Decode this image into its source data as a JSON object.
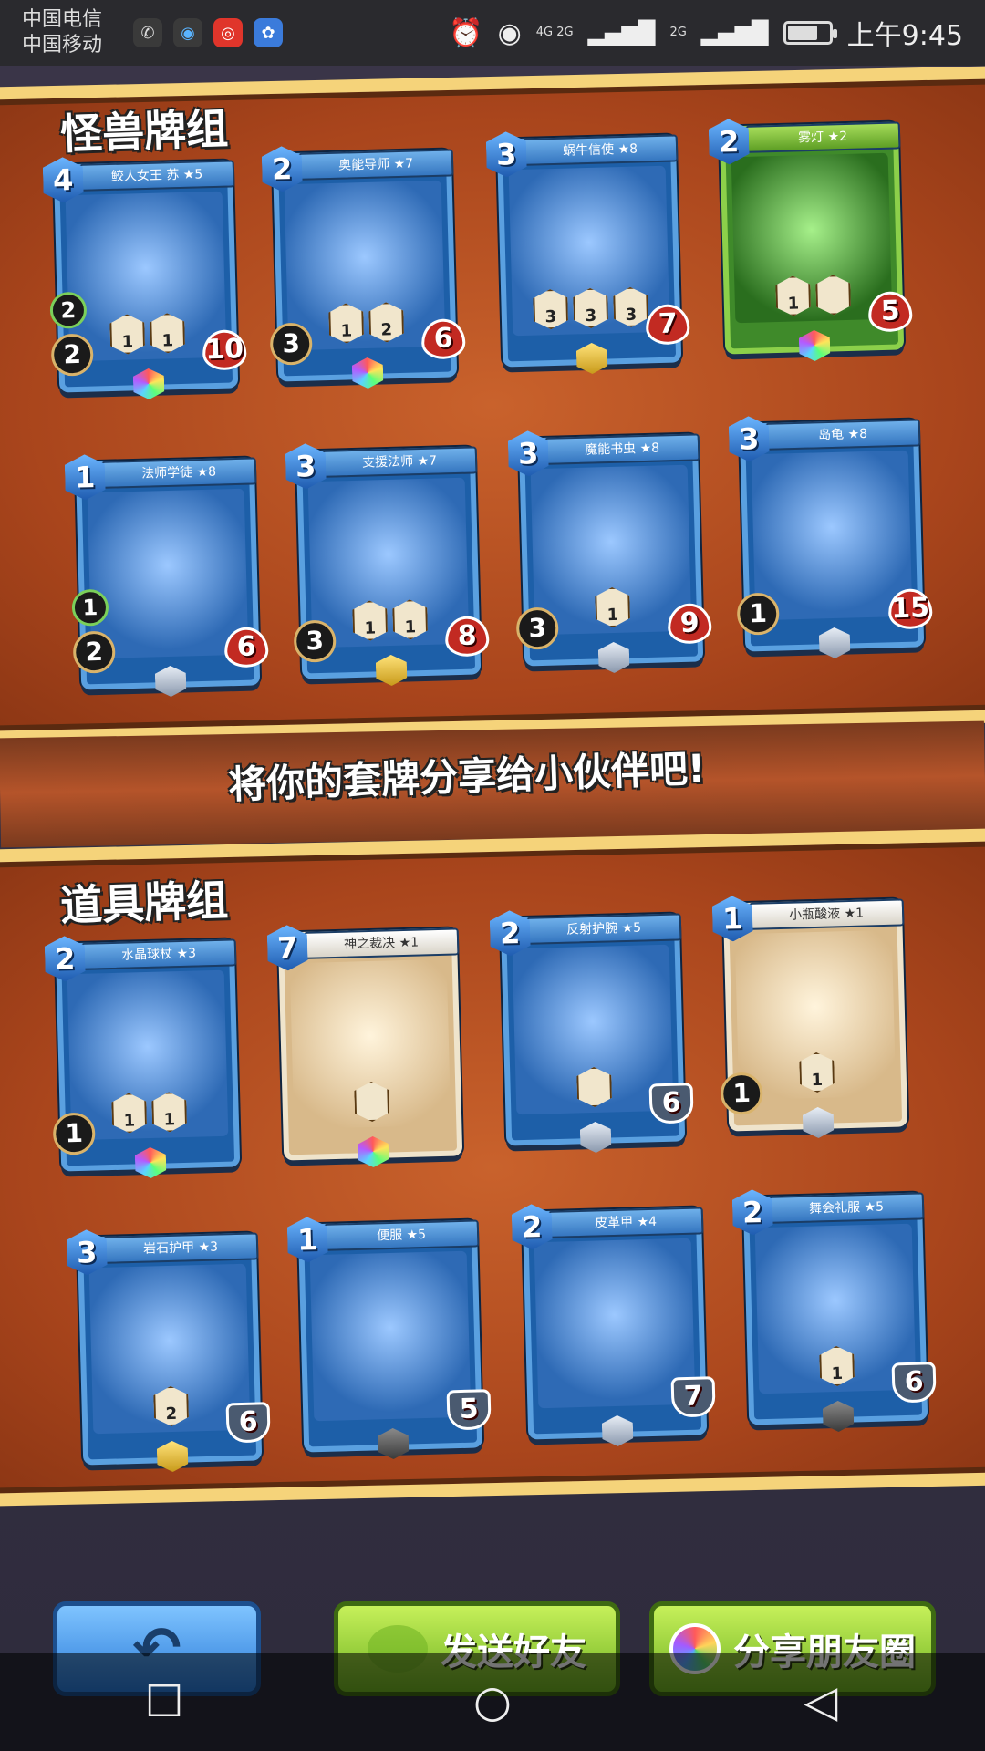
{
  "status_bar": {
    "carrier1": "中国电信",
    "carrier2": "中国移动",
    "net_top": "4G 2G",
    "net_right": "2G",
    "time": "上午9:45",
    "icons": [
      "wechat-icon",
      "qq-icon",
      "weibo-icon",
      "baidu-icon",
      "alarm-icon",
      "eye-icon",
      "signal-icon",
      "battery-icon"
    ]
  },
  "sections": {
    "monster_title": "怪兽牌组",
    "item_title": "道具牌组",
    "share_message": "将你的套牌分享给小伙伴吧!"
  },
  "monster_cards": [
    {
      "name": "鲛人女王 苏 ★5",
      "cost": "4",
      "left": "2",
      "left2": "2",
      "right": "10",
      "skills": [
        "1",
        "1"
      ]
    },
    {
      "name": "奥能导师 ★7",
      "cost": "2",
      "left": "3",
      "right": "6",
      "skills": [
        "1",
        "2"
      ]
    },
    {
      "name": "蜗牛信使 ★8",
      "cost": "3",
      "right": "7",
      "skills": [
        "3",
        "3",
        "3"
      ]
    },
    {
      "name": "雾灯 ★2",
      "cost": "2",
      "right": "5",
      "skills": [
        "1",
        ""
      ]
    },
    {
      "name": "法师学徒 ★8",
      "cost": "1",
      "left": "2",
      "left2": "1",
      "right": "6",
      "skills": []
    },
    {
      "name": "支援法师 ★7",
      "cost": "3",
      "left": "3",
      "right": "8",
      "skills": [
        "1",
        "1"
      ]
    },
    {
      "name": "魔能书虫 ★8",
      "cost": "3",
      "left": "3",
      "right": "9",
      "skills": [
        "1"
      ]
    },
    {
      "name": "岛龟 ★8",
      "cost": "3",
      "left": "1",
      "right": "15",
      "skills": []
    }
  ],
  "item_cards": [
    {
      "name": "水晶球杖 ★3",
      "cost": "2",
      "left": "1",
      "right": "",
      "skills": [
        "1",
        "1"
      ]
    },
    {
      "name": "神之裁决 ★1",
      "cost": "7",
      "left": "",
      "right": "",
      "skills": [
        ""
      ]
    },
    {
      "name": "反射护腕 ★5",
      "cost": "2",
      "left": "",
      "right": "6",
      "skills": [
        ""
      ]
    },
    {
      "name": "小瓶酸液 ★1",
      "cost": "1",
      "left": "1",
      "right": "",
      "skills": [
        "1"
      ]
    },
    {
      "name": "岩石护甲 ★3",
      "cost": "3",
      "left": "",
      "right": "6",
      "skills": [
        "2"
      ]
    },
    {
      "name": "便服 ★5",
      "cost": "1",
      "left": "",
      "right": "5",
      "skills": []
    },
    {
      "name": "皮革甲 ★4",
      "cost": "2",
      "left": "",
      "right": "7",
      "skills": []
    },
    {
      "name": "舞会礼服 ★5",
      "cost": "2",
      "left": "",
      "right": "6",
      "skills": [
        "1"
      ]
    }
  ],
  "buttons": {
    "back_icon": "back-arrow-icon",
    "send_friend": "发送好友",
    "share_moments": "分享朋友圈"
  },
  "colors": {
    "accent_blue": "#2a7ad8",
    "accent_green": "#6fb222",
    "panel_orange": "#b5542a"
  }
}
